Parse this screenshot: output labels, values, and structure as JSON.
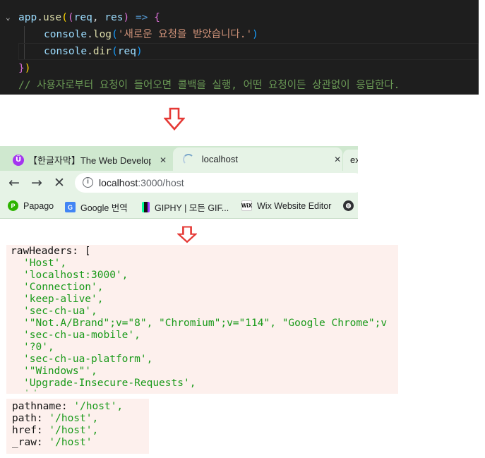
{
  "editor": {
    "line1": {
      "obj": "app",
      "dot": ".",
      "method": "use",
      "p1": "(",
      "p2": "(",
      "arg1": "req",
      "comma": ", ",
      "arg2": "res",
      "p2close": ")",
      "arrow": " =>",
      "brace": " {"
    },
    "line2": {
      "obj": "console",
      "dot": ".",
      "method": "log",
      "p": "(",
      "str": "'새로운 요청을 받았습니다.'",
      "pclose": ")"
    },
    "line3": {
      "obj": "console",
      "dot": ".",
      "method": "dir",
      "p": "(",
      "arg": "req",
      "pclose": ")"
    },
    "line4": {
      "brace": "}",
      "pclose": ")"
    },
    "line5": {
      "comment": "// 사용자로부터 요청이 들어오면 콜백을 실행, 어떤 요청이든 상관없이 응답한다."
    }
  },
  "browser": {
    "tabs": [
      {
        "title": "【한글자막】The Web Developer",
        "favicon": "udemy-icon",
        "favicon_glyph": "Ü",
        "close": "✕"
      },
      {
        "title": "localhost",
        "favicon": "loading-spinner-icon",
        "close": "✕"
      },
      {
        "title": "ex"
      }
    ],
    "nav": {
      "back": "←",
      "forward": "→",
      "stop": "✕"
    },
    "address": {
      "info": "i",
      "host": "localhost",
      "rest": ":3000/host"
    },
    "bookmarks": [
      {
        "label": "Papago",
        "icon": "papago-icon",
        "color": "#2db400"
      },
      {
        "label": "Google 번역",
        "icon": "google-translate-icon",
        "color": "#4285f4"
      },
      {
        "label": "GIPHY | 모든 GIF...",
        "icon": "giphy-icon",
        "color": "#121212"
      },
      {
        "label": "Wix Website Editor",
        "icon": "wix-icon",
        "color": "#000000"
      }
    ]
  },
  "console_output": {
    "raw_headers_label": "rawHeaders: [",
    "raw_headers": [
      "'Host',",
      "'localhost:3000',",
      "'Connection',",
      "'keep-alive',",
      "'sec-ch-ua',",
      "'\"Not.A/Brand\";v=\"8\", \"Chromium\";v=\"114\", \"Google Chrome\";v",
      "'sec-ch-ua-mobile',",
      "'?0',",
      "'sec-ch-ua-platform',",
      "'\"Windows\"',",
      "'Upgrade-Insecure-Requests',"
    ],
    "url_props": [
      {
        "key": "pathname: ",
        "value": "'/host',"
      },
      {
        "key": "path: ",
        "value": "'/host',"
      },
      {
        "key": "href: ",
        "value": "'/host',"
      },
      {
        "key": "_raw: ",
        "value": "'/host'"
      }
    ]
  },
  "colors": {
    "arrow": "#e53935",
    "tab_strip": "#cfe8cf",
    "toolbar": "#e6f3e6",
    "output_bg": "#fdf0ed"
  }
}
